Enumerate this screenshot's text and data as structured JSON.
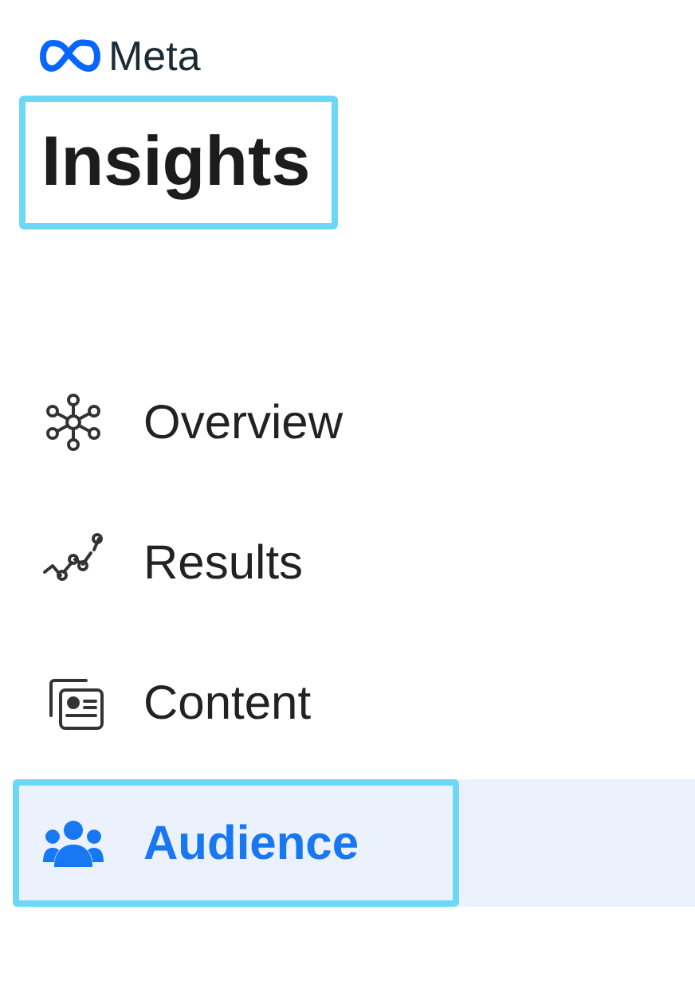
{
  "brand": {
    "name": "Meta"
  },
  "title": {
    "text": "Insights",
    "highlighted": true
  },
  "nav": [
    {
      "kind": "overview",
      "label": "Overview",
      "selected": false,
      "highlighted": false
    },
    {
      "kind": "results",
      "label": "Results",
      "selected": false,
      "highlighted": false
    },
    {
      "kind": "content",
      "label": "Content",
      "selected": false,
      "highlighted": false
    },
    {
      "kind": "audience",
      "label": "Audience",
      "selected": true,
      "highlighted": true
    }
  ]
}
